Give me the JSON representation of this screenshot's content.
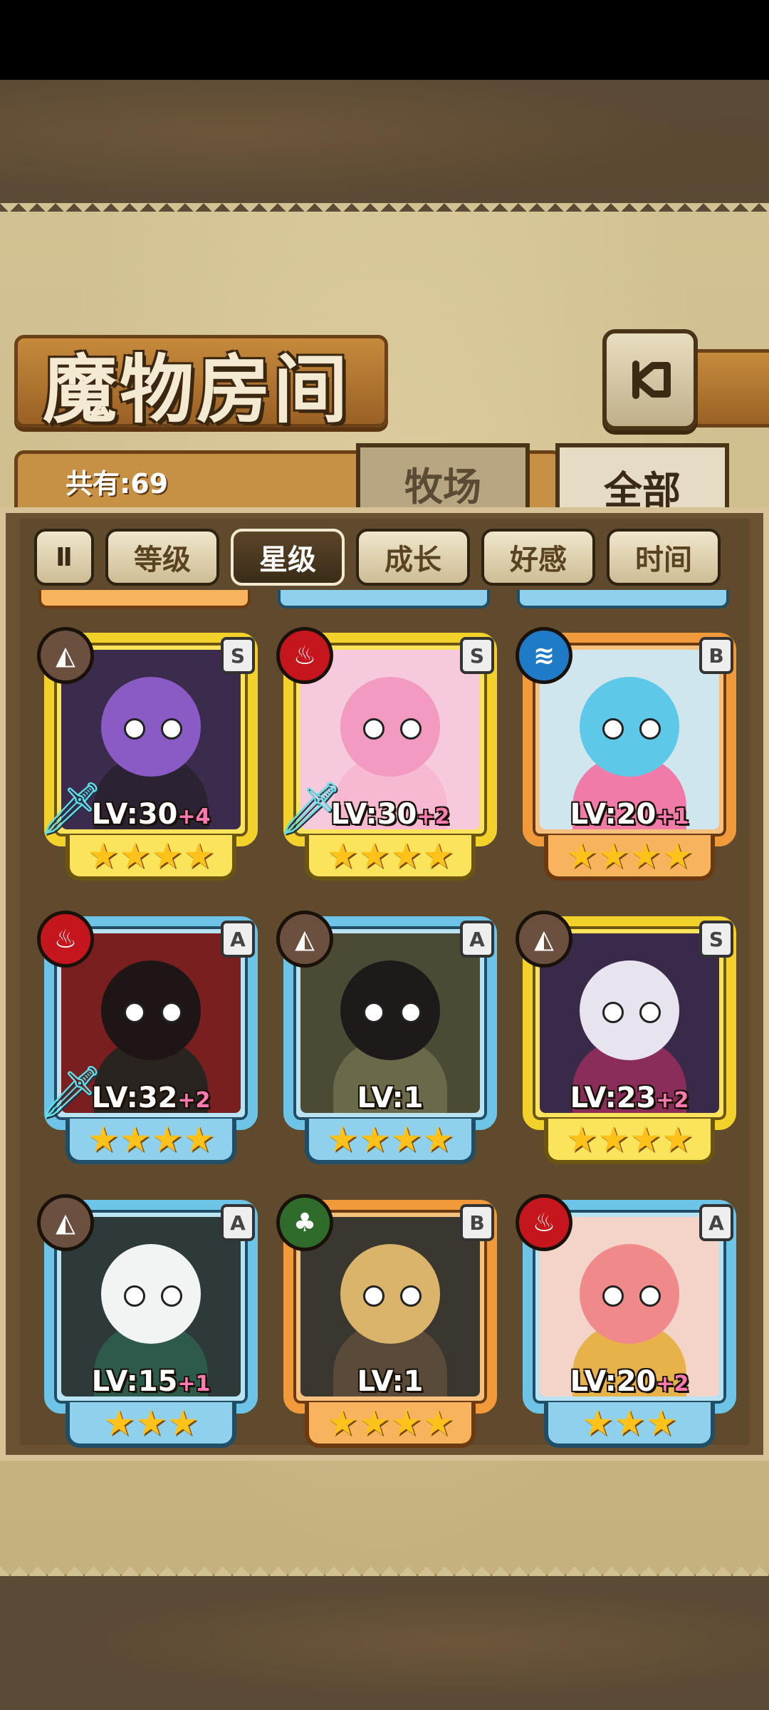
{
  "title": "魔物房间",
  "count_label": "共有:69",
  "tabs": {
    "ranch": "牧场",
    "all": "全部"
  },
  "sort": {
    "toggle_glyph": "Ⅱ",
    "options": [
      "等级",
      "星级",
      "成长",
      "好感",
      "时间"
    ],
    "active": "星级"
  },
  "cards": [
    {
      "element": "earth",
      "rank": "S",
      "level": "LV:30",
      "bonus": "+4",
      "stars": "★★★★",
      "frame": "gold",
      "equipped": true,
      "colors": {
        "bg": "#3b2b4d",
        "hair": "#8a5bc4",
        "body": "#2b2233"
      }
    },
    {
      "element": "fire",
      "rank": "S",
      "level": "LV:30",
      "bonus": "+2",
      "stars": "★★★★",
      "frame": "gold",
      "equipped": true,
      "colors": {
        "bg": "#f6c9dc",
        "hair": "#f29ac0",
        "body": "#f7b8d2"
      }
    },
    {
      "element": "water",
      "rank": "B",
      "level": "LV:20",
      "bonus": "+1",
      "stars": "★★★★",
      "frame": "orange",
      "equipped": false,
      "colors": {
        "bg": "#cfe6ee",
        "hair": "#5ec8e8",
        "body": "#f07aa8"
      }
    },
    {
      "element": "fire",
      "rank": "A",
      "level": "LV:32",
      "bonus": "+2",
      "stars": "★★★★",
      "frame": "blue",
      "equipped": true,
      "colors": {
        "bg": "#7a1f1f",
        "hair": "#1e1616",
        "body": "#2a2420"
      }
    },
    {
      "element": "earth",
      "rank": "A",
      "level": "LV:1",
      "bonus": "",
      "stars": "★★★★",
      "frame": "blue",
      "equipped": false,
      "colors": {
        "bg": "#4a4a35",
        "hair": "#1e1a1a",
        "body": "#6a6a4a"
      }
    },
    {
      "element": "earth",
      "rank": "S",
      "level": "LV:23",
      "bonus": "+2",
      "stars": "★★★★",
      "frame": "gold",
      "equipped": false,
      "colors": {
        "bg": "#3a2a4a",
        "hair": "#e8e4ef",
        "body": "#8a2d5a"
      }
    },
    {
      "element": "earth",
      "rank": "A",
      "level": "LV:15",
      "bonus": "+1",
      "stars": "★★★",
      "frame": "blue",
      "equipped": false,
      "colors": {
        "bg": "#2e3a3a",
        "hair": "#f2f4f4",
        "body": "#2d5a4a"
      }
    },
    {
      "element": "wood",
      "rank": "B",
      "level": "LV:1",
      "bonus": "",
      "stars": "★★★★",
      "frame": "orange",
      "equipped": false,
      "colors": {
        "bg": "#3a3630",
        "hair": "#d9b46a",
        "body": "#5a4a3a"
      }
    },
    {
      "element": "fire",
      "rank": "A",
      "level": "LV:20",
      "bonus": "+2",
      "stars": "★★★",
      "frame": "blue",
      "equipped": false,
      "colors": {
        "bg": "#f4d4c8",
        "hair": "#f08a8a",
        "body": "#e8b24a"
      }
    }
  ],
  "element_glyphs": {
    "earth": "◭",
    "fire": "♨",
    "water": "≋",
    "wood": "♣"
  },
  "equip_glyph": "🗡"
}
